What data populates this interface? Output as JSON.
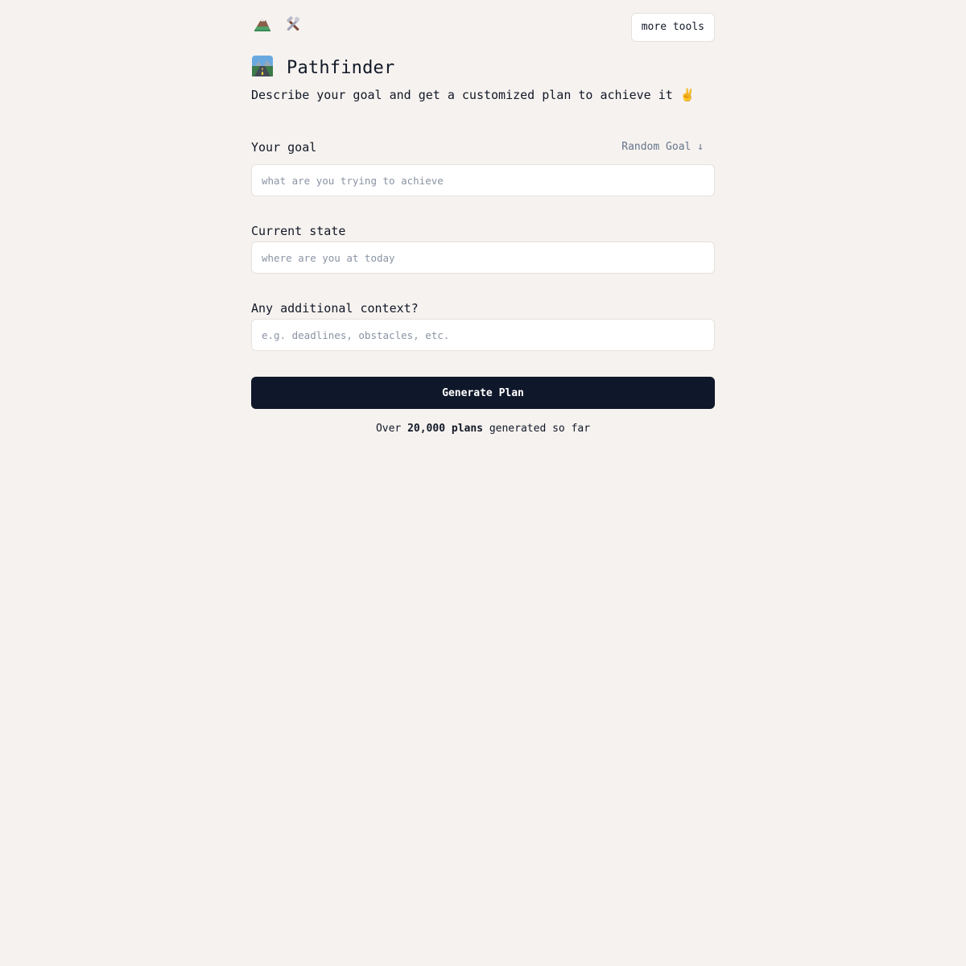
{
  "header": {
    "icons": [
      "mountain-icon",
      "tools-icon"
    ],
    "more_tools_label": "more tools"
  },
  "app": {
    "logo_icon": "road-icon",
    "title": "Pathfinder",
    "subtitle": "Describe your goal and get a customized plan to achieve it",
    "subtitle_icon": "victory-hand-icon"
  },
  "form": {
    "goal": {
      "label": "Your goal",
      "value": "",
      "placeholder": "what are you trying to achieve",
      "random_label": "Random Goal ↓"
    },
    "current_state": {
      "label": "Current state",
      "value": "",
      "placeholder": "where are you at today"
    },
    "context": {
      "label": "Any additional context?",
      "value": "",
      "placeholder": "e.g. deadlines, obstacles, etc."
    },
    "submit_label": "Generate Plan"
  },
  "stats": {
    "prefix": "Over",
    "count": "20,000 plans",
    "suffix": "generated so far"
  },
  "colors": {
    "background": "#f6f2ef",
    "primary_button": "#0f172a",
    "muted_text": "#64748b"
  }
}
